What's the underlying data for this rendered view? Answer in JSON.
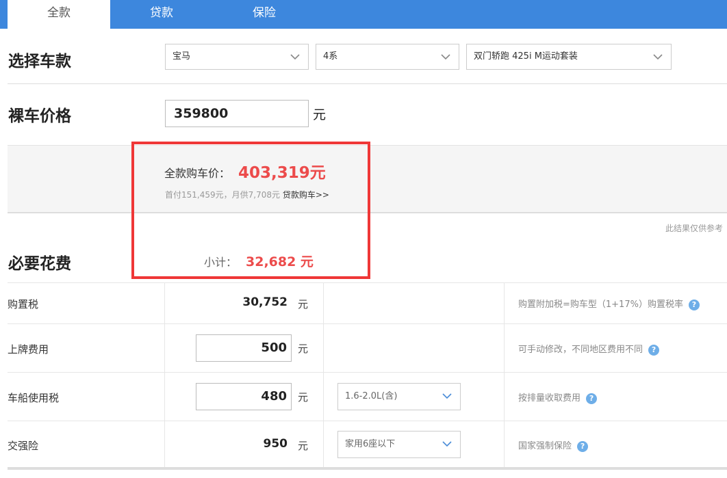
{
  "tabs": [
    {
      "label": "全款"
    },
    {
      "label": "贷款"
    },
    {
      "label": "保险"
    }
  ],
  "select_car": {
    "heading": "选择车款",
    "brand": "宝马",
    "series": "4系",
    "model": "双门轿跑 425i M运动套装"
  },
  "bare_price": {
    "heading": "裸车价格",
    "value": "359800",
    "unit": "元"
  },
  "result": {
    "total_label": "全款购车价：",
    "total_value": "403,319元",
    "loan_info": "首付151,459元，月供7,708元",
    "loan_link": "贷款购车>>",
    "note": "此结果仅供参考"
  },
  "required": {
    "heading": "必要花费",
    "subtotal_label": "小计：",
    "subtotal_value": "32,682 元"
  },
  "fees": [
    {
      "name": "购置税",
      "value": "30,752",
      "unit": "元",
      "desc": "购置附加税=购车型（1+17%）购置税率"
    },
    {
      "name": "上牌费用",
      "value": "500",
      "unit": "元",
      "desc": "可手动修改，不同地区费用不同"
    },
    {
      "name": "车船使用税",
      "value": "480",
      "unit": "元",
      "option": "1.6-2.0L(含)",
      "desc": "按排量收取费用"
    },
    {
      "name": "交强险",
      "value": "950",
      "unit": "元",
      "option": "家用6座以下",
      "desc": "国家强制保险"
    }
  ],
  "help_icon": "?",
  "colors": {
    "tab_bar": "#3d87dd",
    "price_red": "#ec4b4b",
    "highlight_box": "#ef3737",
    "help_icon": "#6eaee8"
  }
}
